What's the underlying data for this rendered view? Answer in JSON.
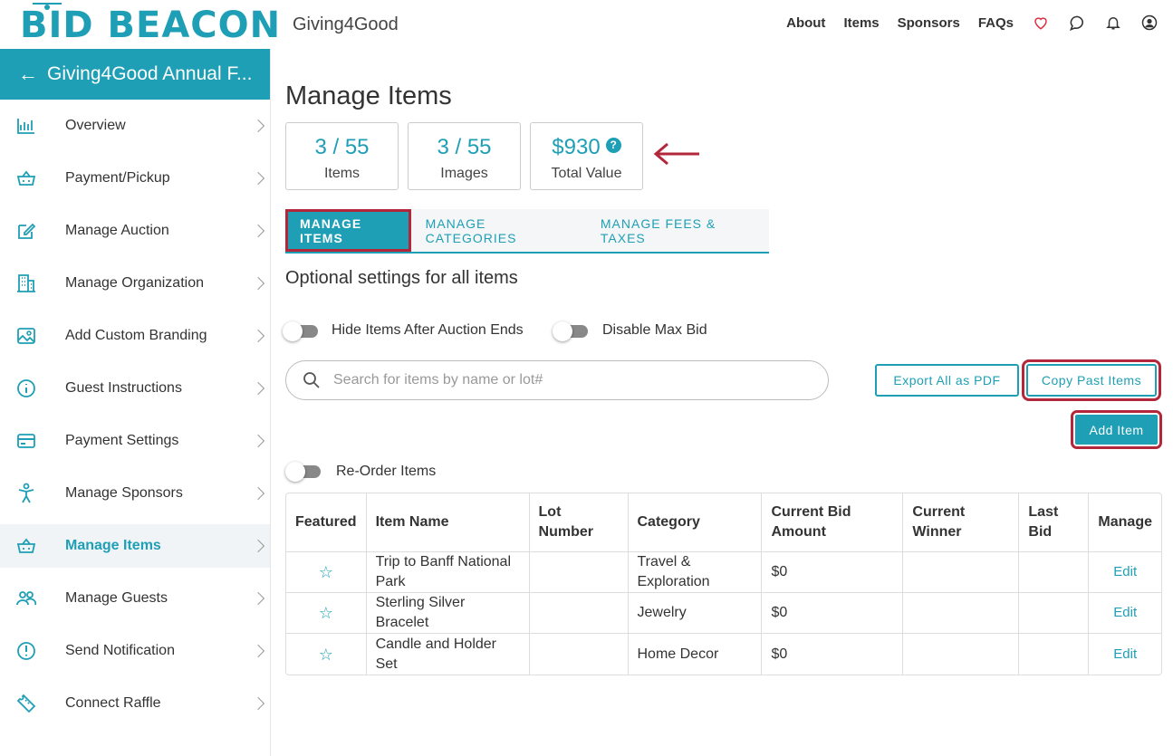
{
  "header": {
    "logo_text": "BID BEACON",
    "org_name": "Giving4Good",
    "nav": [
      "About",
      "Items",
      "Sponsors",
      "FAQs"
    ],
    "icons": [
      "heart-icon",
      "chat-icon",
      "bell-icon",
      "user-icon"
    ]
  },
  "sidebar": {
    "title": "Giving4Good Annual F...",
    "items": [
      {
        "label": "Overview",
        "icon": "bar-chart-icon"
      },
      {
        "label": "Payment/Pickup",
        "icon": "basket-icon"
      },
      {
        "label": "Manage Auction",
        "icon": "edit-icon"
      },
      {
        "label": "Manage Organization",
        "icon": "building-icon"
      },
      {
        "label": "Add Custom Branding",
        "icon": "image-icon"
      },
      {
        "label": "Guest Instructions",
        "icon": "info-icon"
      },
      {
        "label": "Payment Settings",
        "icon": "credit-card-icon"
      },
      {
        "label": "Manage Sponsors",
        "icon": "person-icon"
      },
      {
        "label": "Manage Items",
        "icon": "basket-icon",
        "active": true
      },
      {
        "label": "Manage Guests",
        "icon": "users-icon"
      },
      {
        "label": "Send Notification",
        "icon": "alert-icon"
      },
      {
        "label": "Connect Raffle",
        "icon": "ticket-icon"
      }
    ]
  },
  "main": {
    "title": "Manage Items",
    "stats": [
      {
        "value": "3 / 55",
        "label": "Items"
      },
      {
        "value": "3 / 55",
        "label": "Images"
      },
      {
        "value": "$930",
        "label": "Total Value"
      }
    ],
    "tabs": [
      "MANAGE ITEMS",
      "MANAGE CATEGORIES",
      "MANAGE FEES & TAXES"
    ],
    "section_title": "Optional settings for all items",
    "toggles": {
      "hide_items": "Hide Items After Auction Ends",
      "disable_max_bid": "Disable Max Bid",
      "reorder": "Re-Order Items"
    },
    "search_placeholder": "Search for items by name or lot#",
    "buttons": {
      "export": "Export All as PDF",
      "copy_past": "Copy Past Items",
      "add_item": "Add Item"
    },
    "table": {
      "headers": [
        "Featured",
        "Item Name",
        "Lot Number",
        "Category",
        "Current Bid Amount",
        "Current Winner",
        "Last Bid",
        "Manage"
      ],
      "rows": [
        {
          "name": "Trip to Banff National Park",
          "lot": "",
          "category": "Travel & Exploration",
          "bid": "$0",
          "winner": "",
          "last_bid": "",
          "action": "Edit"
        },
        {
          "name": "Sterling Silver Bracelet",
          "lot": "",
          "category": "Jewelry",
          "bid": "$0",
          "winner": "",
          "last_bid": "",
          "action": "Edit"
        },
        {
          "name": "Candle and Holder Set",
          "lot": "",
          "category": "Home Decor",
          "bid": "$0",
          "winner": "",
          "last_bid": "",
          "action": "Edit"
        }
      ]
    }
  },
  "colors": {
    "accent": "#1e9fb5",
    "highlight": "#b2283a"
  }
}
